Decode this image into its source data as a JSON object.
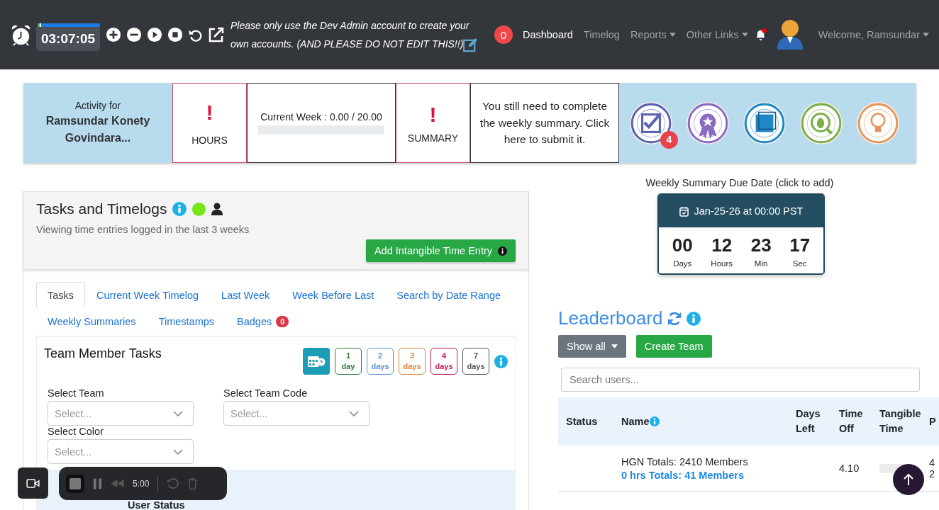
{
  "navbar": {
    "timer": {
      "time": "03:07:05",
      "level": 0.03
    },
    "notice": "Please only use the Dev Admin account to create your own accounts. (AND PLEASE DO NOT EDIT THIS!!)",
    "notification_count": "0",
    "links": [
      {
        "label": "Dashboard",
        "selected": true,
        "dropdown": false
      },
      {
        "label": "Timelog",
        "selected": false,
        "dropdown": false
      },
      {
        "label": "Reports",
        "selected": false,
        "dropdown": true
      },
      {
        "label": "Other Links",
        "selected": false,
        "dropdown": true
      }
    ],
    "bell_unread": true,
    "welcome": "Welcome, Ramsundar"
  },
  "summary_bar": {
    "activity_label": "Activity for",
    "user_name": "Ramsundar Konety Govindara...",
    "hours": {
      "alert": "!",
      "label": "HOURS"
    },
    "current_week": {
      "text": "Current Week : 0.00 / 20.00",
      "level": 0
    },
    "summary": {
      "alert": "!",
      "label": "SUMMARY"
    },
    "message": "You still need to complete the weekly summary. Click here to submit it.",
    "badges": [
      {
        "kind": "tasks",
        "color": "#5b63b0",
        "count": "4"
      },
      {
        "kind": "earned",
        "color": "#8a6bc0"
      },
      {
        "kind": "square",
        "color": "#1e88c8"
      },
      {
        "kind": "bug",
        "color": "#7cae4a"
      },
      {
        "kind": "bulb",
        "color": "#e8955a"
      }
    ]
  },
  "tasks_panel": {
    "title": "Tasks and Timelogs",
    "status_dot": {
      "color": "#76e619"
    },
    "subtitle": "Viewing time entries logged in the last 3 weeks",
    "add_button": "Add Intangible Time Entry",
    "tab_rows": [
      {
        "tabs": [
          {
            "label": "Tasks",
            "selected": true
          },
          {
            "label": "Current Week Timelog",
            "selected": false
          },
          {
            "label": "Last Week",
            "selected": false
          },
          {
            "label": "Week Before Last",
            "selected": false
          },
          {
            "label": "Search by Date Range",
            "selected": false
          }
        ]
      },
      {
        "tabs": [
          {
            "label": "Weekly Summaries",
            "selected": false
          },
          {
            "label": "Timestamps",
            "selected": false
          },
          {
            "label": "Badges",
            "selected": false,
            "count": "0"
          }
        ]
      }
    ],
    "team_tasks": {
      "title": "Team Member Tasks",
      "day_filters": [
        {
          "number": "1",
          "unit": "day",
          "color": "#2e7d32"
        },
        {
          "number": "2",
          "unit": "days",
          "color": "#5b8fd9"
        },
        {
          "number": "3",
          "unit": "days",
          "color": "#e0823a"
        },
        {
          "number": "4",
          "unit": "days",
          "color": "#c2185b"
        },
        {
          "number": "7",
          "unit": "days",
          "color": "#555555"
        }
      ],
      "selects": [
        {
          "label": "Select Team",
          "placeholder": "Select..."
        },
        {
          "label": "Select Team Code",
          "placeholder": "Select..."
        },
        {
          "label": "Select Color",
          "placeholder": "Select..."
        }
      ],
      "status_header": "User Status"
    }
  },
  "due_date": {
    "label": "Weekly Summary Due Date (click to add)",
    "date": "Jan-25-26 at 00:00 PST",
    "countdown": [
      {
        "value": "00",
        "unit": "Days"
      },
      {
        "value": "12",
        "unit": "Hours"
      },
      {
        "value": "23",
        "unit": "Min"
      },
      {
        "value": "17",
        "unit": "Sec"
      }
    ]
  },
  "leaderboard": {
    "title": "Leaderboard",
    "filter": "Show all",
    "create_button": "Create Team",
    "search_placeholder": "Search users...",
    "columns": [
      "Status",
      "Name",
      "Days Left",
      "Time Off",
      "Tangible Time",
      "P"
    ],
    "rows": [
      {
        "name": "HGN Totals: 2410 Members",
        "subline": "0 hrs Totals: 41 Members",
        "time_off": "4.10",
        "tangible_time": {
          "level": 0
        },
        "column_6": [
          "4",
          "2"
        ]
      }
    ]
  },
  "recorder": {
    "time": "5:00"
  }
}
